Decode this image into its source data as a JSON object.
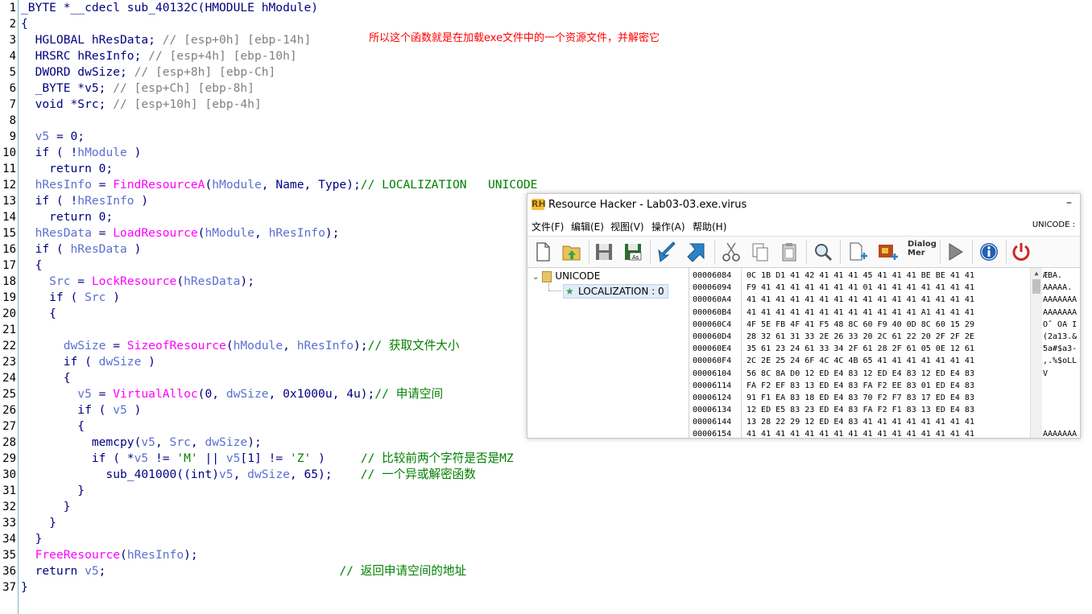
{
  "code_lines": [
    {
      "n": "1",
      "parts": [
        {
          "t": "_BYTE *__cdecl sub_40132C(HMODULE hModule)",
          "c": ""
        }
      ],
      "indent": 0
    },
    {
      "n": "2",
      "parts": [
        {
          "t": "{",
          "c": ""
        }
      ],
      "indent": 0
    },
    {
      "n": "3",
      "parts": [
        {
          "t": "  HGLOBAL hResData; ",
          "c": ""
        },
        {
          "t": "// [esp+0h] [ebp-14h]",
          "c": "cmtg"
        }
      ],
      "indent": 0
    },
    {
      "n": "4",
      "parts": [
        {
          "t": "  HRSRC hResInfo; ",
          "c": ""
        },
        {
          "t": "// [esp+4h] [ebp-10h]",
          "c": "cmtg"
        }
      ],
      "indent": 0
    },
    {
      "n": "5",
      "parts": [
        {
          "t": "  DWORD dwSize; ",
          "c": ""
        },
        {
          "t": "// [esp+8h] [ebp-Ch]",
          "c": "cmtg"
        }
      ],
      "indent": 0
    },
    {
      "n": "6",
      "parts": [
        {
          "t": "  _BYTE *v5; ",
          "c": ""
        },
        {
          "t": "// [esp+Ch] [ebp-8h]",
          "c": "cmtg"
        }
      ],
      "indent": 0
    },
    {
      "n": "7",
      "parts": [
        {
          "t": "  void *Src; ",
          "c": ""
        },
        {
          "t": "// [esp+10h] [ebp-4h]",
          "c": "cmtg"
        }
      ],
      "indent": 0
    },
    {
      "n": "8",
      "parts": [
        {
          "t": "",
          "c": ""
        }
      ],
      "indent": 0
    },
    {
      "n": "9",
      "parts": [
        {
          "t": "  ",
          "c": ""
        },
        {
          "t": "v5",
          "c": "var"
        },
        {
          "t": " = 0;",
          "c": ""
        }
      ],
      "indent": 0
    },
    {
      "n": "10",
      "parts": [
        {
          "t": "  if ( !",
          "c": ""
        },
        {
          "t": "hModule",
          "c": "var"
        },
        {
          "t": " )",
          "c": ""
        }
      ],
      "indent": 0
    },
    {
      "n": "11",
      "parts": [
        {
          "t": "    return 0;",
          "c": ""
        }
      ],
      "indent": 0
    },
    {
      "n": "12",
      "parts": [
        {
          "t": "  ",
          "c": ""
        },
        {
          "t": "hResInfo",
          "c": "var"
        },
        {
          "t": " = ",
          "c": ""
        },
        {
          "t": "FindResourceA",
          "c": "fn"
        },
        {
          "t": "(",
          "c": ""
        },
        {
          "t": "hModule",
          "c": "var"
        },
        {
          "t": ", Name, Type);",
          "c": ""
        },
        {
          "t": "// LOCALIZATION   UNICODE",
          "c": "cmt"
        }
      ],
      "indent": 0
    },
    {
      "n": "13",
      "parts": [
        {
          "t": "  if ( !",
          "c": ""
        },
        {
          "t": "hResInfo",
          "c": "var"
        },
        {
          "t": " )",
          "c": ""
        }
      ],
      "indent": 0
    },
    {
      "n": "14",
      "parts": [
        {
          "t": "    return 0;",
          "c": ""
        }
      ],
      "indent": 0
    },
    {
      "n": "15",
      "parts": [
        {
          "t": "  ",
          "c": ""
        },
        {
          "t": "hResData",
          "c": "var"
        },
        {
          "t": " = ",
          "c": ""
        },
        {
          "t": "LoadResource",
          "c": "fn"
        },
        {
          "t": "(",
          "c": ""
        },
        {
          "t": "hModule",
          "c": "var"
        },
        {
          "t": ", ",
          "c": ""
        },
        {
          "t": "hResInfo",
          "c": "var"
        },
        {
          "t": ");",
          "c": ""
        }
      ],
      "indent": 0
    },
    {
      "n": "16",
      "parts": [
        {
          "t": "  if ( ",
          "c": ""
        },
        {
          "t": "hResData",
          "c": "var"
        },
        {
          "t": " )",
          "c": ""
        }
      ],
      "indent": 0
    },
    {
      "n": "17",
      "parts": [
        {
          "t": "  {",
          "c": ""
        }
      ],
      "indent": 0
    },
    {
      "n": "18",
      "parts": [
        {
          "t": "    ",
          "c": ""
        },
        {
          "t": "Src",
          "c": "var"
        },
        {
          "t": " = ",
          "c": ""
        },
        {
          "t": "LockResource",
          "c": "fn"
        },
        {
          "t": "(",
          "c": ""
        },
        {
          "t": "hResData",
          "c": "var"
        },
        {
          "t": ");",
          "c": ""
        }
      ],
      "indent": 0
    },
    {
      "n": "19",
      "parts": [
        {
          "t": "    if ( ",
          "c": ""
        },
        {
          "t": "Src",
          "c": "var"
        },
        {
          "t": " )",
          "c": ""
        }
      ],
      "indent": 0
    },
    {
      "n": "20",
      "parts": [
        {
          "t": "    {",
          "c": ""
        }
      ],
      "indent": 0
    },
    {
      "n": "21",
      "parts": [
        {
          "t": "",
          "c": ""
        }
      ],
      "indent": 0
    },
    {
      "n": "22",
      "parts": [
        {
          "t": "      ",
          "c": ""
        },
        {
          "t": "dwSize",
          "c": "var"
        },
        {
          "t": " = ",
          "c": ""
        },
        {
          "t": "SizeofResource",
          "c": "fn"
        },
        {
          "t": "(",
          "c": ""
        },
        {
          "t": "hModule",
          "c": "var"
        },
        {
          "t": ", ",
          "c": ""
        },
        {
          "t": "hResInfo",
          "c": "var"
        },
        {
          "t": ");",
          "c": ""
        },
        {
          "t": "// 获取文件大小",
          "c": "cmt"
        }
      ],
      "indent": 0
    },
    {
      "n": "23",
      "parts": [
        {
          "t": "      if ( ",
          "c": ""
        },
        {
          "t": "dwSize",
          "c": "var"
        },
        {
          "t": " )",
          "c": ""
        }
      ],
      "indent": 0
    },
    {
      "n": "24",
      "parts": [
        {
          "t": "      {",
          "c": ""
        }
      ],
      "indent": 0
    },
    {
      "n": "25",
      "parts": [
        {
          "t": "        ",
          "c": ""
        },
        {
          "t": "v5",
          "c": "var"
        },
        {
          "t": " = ",
          "c": ""
        },
        {
          "t": "VirtualAlloc",
          "c": "fn"
        },
        {
          "t": "(0, ",
          "c": ""
        },
        {
          "t": "dwSize",
          "c": "var"
        },
        {
          "t": ", 0x1000u, 4u);",
          "c": ""
        },
        {
          "t": "// 申请空间",
          "c": "cmt"
        }
      ],
      "indent": 0
    },
    {
      "n": "26",
      "parts": [
        {
          "t": "        if ( ",
          "c": ""
        },
        {
          "t": "v5",
          "c": "var"
        },
        {
          "t": " )",
          "c": ""
        }
      ],
      "indent": 0
    },
    {
      "n": "27",
      "parts": [
        {
          "t": "        {",
          "c": ""
        }
      ],
      "indent": 0
    },
    {
      "n": "28",
      "parts": [
        {
          "t": "          memcpy(",
          "c": ""
        },
        {
          "t": "v5",
          "c": "var"
        },
        {
          "t": ", ",
          "c": ""
        },
        {
          "t": "Src",
          "c": "var"
        },
        {
          "t": ", ",
          "c": ""
        },
        {
          "t": "dwSize",
          "c": "var"
        },
        {
          "t": ");",
          "c": ""
        }
      ],
      "indent": 0
    },
    {
      "n": "29",
      "parts": [
        {
          "t": "          if ( *",
          "c": ""
        },
        {
          "t": "v5",
          "c": "var"
        },
        {
          "t": " != ",
          "c": ""
        },
        {
          "t": "'M'",
          "c": "str"
        },
        {
          "t": " || ",
          "c": ""
        },
        {
          "t": "v5",
          "c": "var"
        },
        {
          "t": "[1] != ",
          "c": ""
        },
        {
          "t": "'Z'",
          "c": "str"
        },
        {
          "t": " )     ",
          "c": ""
        },
        {
          "t": "// 比较前两个字符是否是MZ",
          "c": "cmt"
        }
      ],
      "indent": 0
    },
    {
      "n": "30",
      "parts": [
        {
          "t": "            sub_401000((int)",
          "c": ""
        },
        {
          "t": "v5",
          "c": "var"
        },
        {
          "t": ", ",
          "c": ""
        },
        {
          "t": "dwSize",
          "c": "var"
        },
        {
          "t": ", 65);    ",
          "c": ""
        },
        {
          "t": "// 一个异或解密函数",
          "c": "cmt"
        }
      ],
      "indent": 0
    },
    {
      "n": "31",
      "parts": [
        {
          "t": "        }",
          "c": ""
        }
      ],
      "indent": 0
    },
    {
      "n": "32",
      "parts": [
        {
          "t": "      }",
          "c": ""
        }
      ],
      "indent": 0
    },
    {
      "n": "33",
      "parts": [
        {
          "t": "    }",
          "c": ""
        }
      ],
      "indent": 0
    },
    {
      "n": "34",
      "parts": [
        {
          "t": "  }",
          "c": ""
        }
      ],
      "indent": 0
    },
    {
      "n": "35",
      "parts": [
        {
          "t": "  ",
          "c": ""
        },
        {
          "t": "FreeResource",
          "c": "fn"
        },
        {
          "t": "(",
          "c": ""
        },
        {
          "t": "hResInfo",
          "c": "var"
        },
        {
          "t": ");",
          "c": ""
        }
      ],
      "indent": 0
    },
    {
      "n": "36",
      "parts": [
        {
          "t": "  return ",
          "c": ""
        },
        {
          "t": "v5",
          "c": "var"
        },
        {
          "t": ";                                 ",
          "c": ""
        },
        {
          "t": "// 返回申请空间的地址",
          "c": "cmt"
        }
      ],
      "indent": 0
    },
    {
      "n": "37",
      "parts": [
        {
          "t": "}",
          "c": ""
        }
      ],
      "indent": 0
    }
  ],
  "annotation_note": "所以这个函数就是在加载exe文件中的一个资源文件，并解密它",
  "resource_hacker": {
    "title": "Resource Hacker - Lab03-03.exe.virus",
    "minimize_label": "–",
    "menu": [
      "文件(F)",
      "编辑(E)",
      "视图(V)",
      "操作(A)",
      "帮助(H)"
    ],
    "encoding_label": "UNICODE :",
    "toolbar_dialog_label_1": "Dialog",
    "toolbar_dialog_label_2": "Mer",
    "tree_root": "UNICODE",
    "tree_child": "LOCALIZATION : 0",
    "hex_addresses": [
      "00006084",
      "00006094",
      "000060A4",
      "000060B4",
      "000060C4",
      "000060D4",
      "000060E4",
      "000060F4",
      "00006104",
      "00006114",
      "00006124",
      "00006134",
      "00006144",
      "00006154"
    ],
    "hex_bytes": [
      "0C 1B D1 41 42 41 41 41 45 41 41 41 BE BE 41 41",
      "F9 41 41 41 41 41 41 41 01 41 41 41 41 41 41 41",
      "41 41 41 41 41 41 41 41 41 41 41 41 41 41 41 41",
      "41 41 41 41 41 41 41 41 41 41 41 41 A1 41 41 41",
      "4F 5E FB 4F 41 F5 48 8C 60 F9 40 0D 8C 60 15 29",
      "28 32 61 31 33 2E 26 33 20 2C 61 22 20 2F 2F 2E",
      "35 61 23 24 61 33 34 2F 61 28 2F 61 05 0E 12 61",
      "2C 2E 25 24 6F 4C 4C 4B 65 41 41 41 41 41 41 41",
      "56 8C 8A D0 12 ED E4 83 12 ED E4 83 12 ED E4 83",
      "FA F2 EF 83 13 ED E4 83 FA F2 EE 83 01 ED E4 83",
      "91 F1 EA 83 18 ED E4 83 70 F2 F7 83 17 ED E4 83",
      "12 ED E5 83 23 ED E4 83 FA F2 F1 83 13 ED E4 83",
      "13 28 22 29 12 ED E4 83 41 41 41 41 41 41 41 41",
      "41 41 41 41 41 41 41 41 41 41 41 41 41 41 41 41"
    ],
    "hex_ascii": [
      "   ÆBA.",
      "  AAAAA.",
      "AAAAAAA",
      "AAAAAAA",
      "Oˆ OA I",
      "(2a13.&",
      "5a#$a3-",
      ",.%$oLL",
      "V",
      "",
      "",
      "",
      "",
      "AAAAAAA"
    ]
  },
  "colors": {
    "keyword": "#000080",
    "function": "#ff00ff",
    "variable": "#5a6fd0",
    "comment": "#008000",
    "comment_gray": "#808080",
    "note": "#ff0000"
  }
}
